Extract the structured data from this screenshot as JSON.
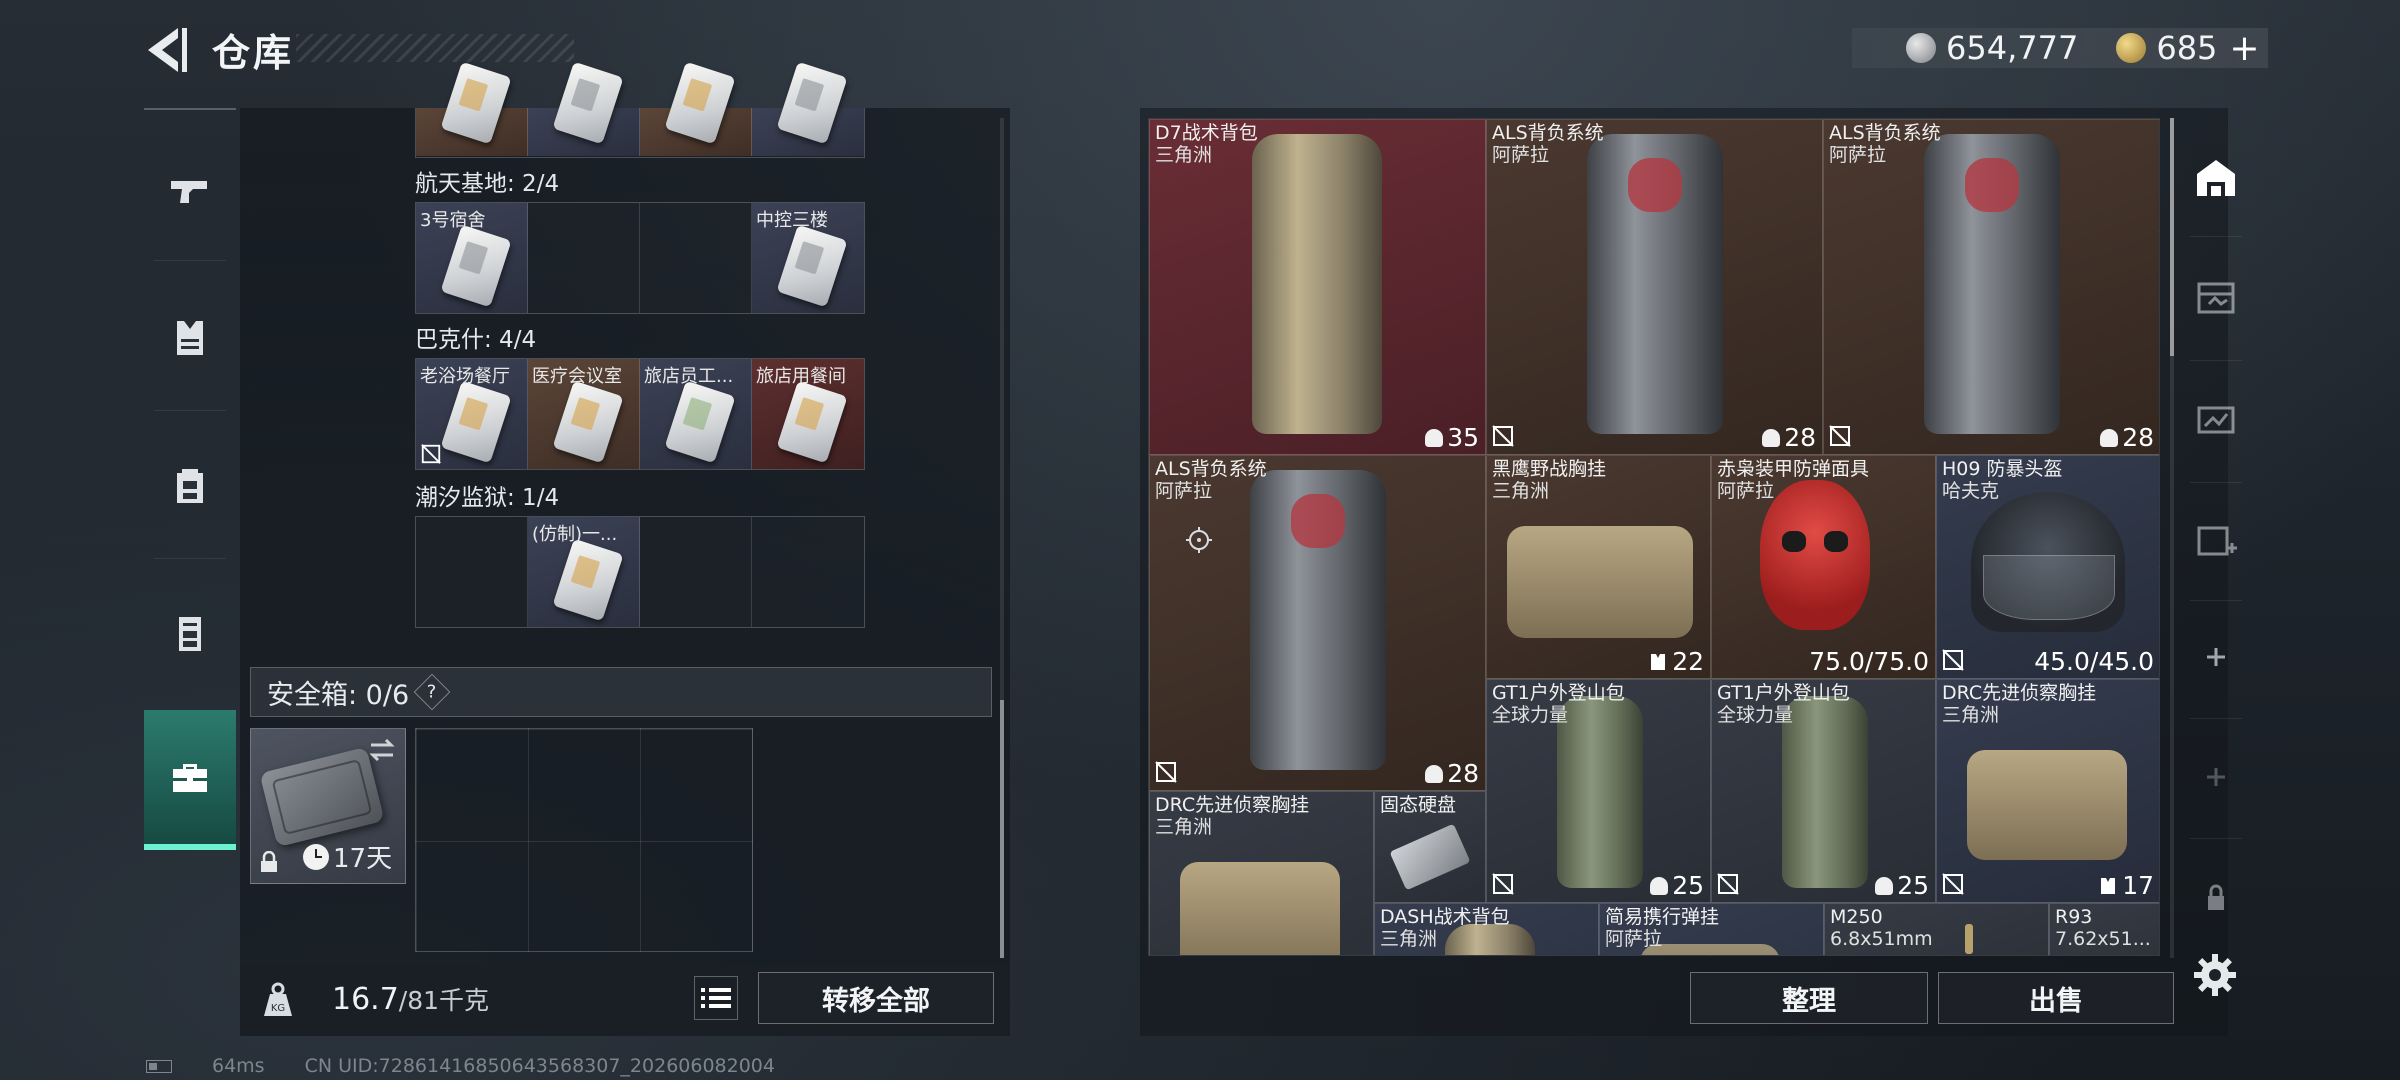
{
  "header": {
    "title": "仓库",
    "currency_1": "654,777",
    "currency_2": "685"
  },
  "sidebar": {
    "tabs": [
      {
        "name": "weapons",
        "icon": "pistol-icon"
      },
      {
        "name": "armor",
        "icon": "vest-icon"
      },
      {
        "name": "backpack",
        "icon": "backpack-icon"
      },
      {
        "name": "chest-rig",
        "icon": "chest-rig-icon"
      },
      {
        "name": "safe-case",
        "icon": "briefcase-icon",
        "active": true
      }
    ]
  },
  "storage": {
    "groups": [
      {
        "label": "航天基地: 2/4",
        "slots": [
          {
            "label": "3号宿舍",
            "card": "plain"
          },
          {
            "label": ""
          },
          {
            "label": ""
          },
          {
            "label": "中控三楼",
            "card": "plain"
          }
        ]
      },
      {
        "label": "巴克什: 4/4",
        "slots": [
          {
            "label": "老浴场餐厅",
            "card": "gold"
          },
          {
            "label": "医疗会议室",
            "card": "gold"
          },
          {
            "label": "旅店员工...",
            "card": "green"
          },
          {
            "label": "旅店用餐间",
            "card": "gold"
          }
        ]
      },
      {
        "label": "潮汐监狱: 1/4",
        "slots": [
          {
            "label": ""
          },
          {
            "label": "(仿制)一...",
            "card": "gold"
          },
          {
            "label": ""
          },
          {
            "label": ""
          }
        ]
      }
    ],
    "safebox_label": "安全箱: 0/6",
    "help": "?",
    "safebox_timer": "17天",
    "weight_current": "16.7",
    "weight_max": "/81千克",
    "transfer_all": "转移全部"
  },
  "status": {
    "ping": "64ms",
    "uid": "CN UID:7286141685064356830​7_202606082004"
  },
  "inventory": {
    "items": [
      {
        "name": "D7战术背包",
        "maker": "三角洲",
        "stat": "35"
      },
      {
        "name": "ALS背负系统",
        "maker": "阿萨拉",
        "stat": "28"
      },
      {
        "name": "ALS背负系统",
        "maker": "阿萨拉",
        "stat": "28"
      },
      {
        "name": "ALS背负系统",
        "maker": "阿萨拉",
        "stat": "28"
      },
      {
        "name": "黑鹰野战胸挂",
        "maker": "三角洲",
        "stat": "22"
      },
      {
        "name": "赤枭装甲防弹面具",
        "maker": "阿萨拉",
        "stat": "75.0/75.0"
      },
      {
        "name": "H09 防暴头盔",
        "maker": "哈夫克",
        "stat": "45.0/45.0"
      },
      {
        "name": "GT1户外登山包",
        "maker": "全球力量",
        "stat": "25"
      },
      {
        "name": "GT1户外登山包",
        "maker": "全球力量",
        "stat": "25"
      },
      {
        "name": "DRC先进侦察胸挂",
        "maker": "三角洲",
        "stat": "17"
      },
      {
        "name": "DRC先进侦察胸挂",
        "maker": "三角洲",
        "stat": ""
      },
      {
        "name": "固态硬盘",
        "maker": "",
        "stat": ""
      },
      {
        "name": "DASH战术背包",
        "maker": "三角洲",
        "stat": ""
      },
      {
        "name": "简易携行弹挂",
        "maker": "阿萨拉",
        "stat": ""
      },
      {
        "name": "M250",
        "maker": "6.8x51mm",
        "stat": ""
      },
      {
        "name": "R93",
        "maker": "7.62x51...",
        "stat": ""
      }
    ],
    "sort_label": "整理",
    "sell_label": "出售"
  }
}
